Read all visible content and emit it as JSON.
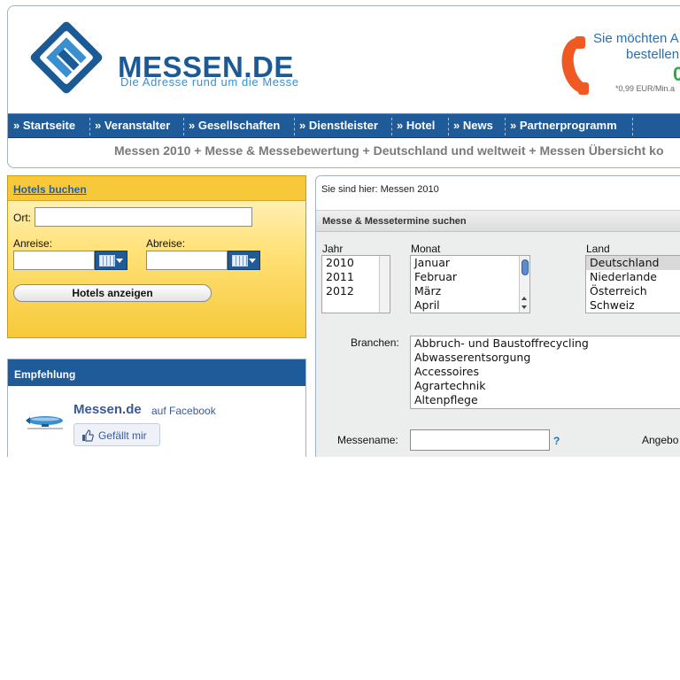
{
  "header": {
    "logo_text": "MESSEN.DE",
    "logo_sub": "Die Adresse rund um die Messe",
    "phone_line1": "Sie möchten A",
    "phone_line2": "bestellen",
    "phone_big": "0",
    "phone_price": "*0,99 EUR/Min.a",
    "tagline": "Messen 2010 + Messe & Messebewertung + Deutschland und weltweit + Messen Übersicht ko",
    "colors": {
      "brand": "#1c5a96",
      "nav": "#1f5a99",
      "accent": "#3a8fd0",
      "phone": "#f05a22"
    }
  },
  "nav": {
    "items": [
      {
        "label": "» Startseite"
      },
      {
        "label": "» Veranstalter"
      },
      {
        "label": "» Gesellschaften"
      },
      {
        "label": "» Dienstleister"
      },
      {
        "label": "» Hotel"
      },
      {
        "label": "» News"
      },
      {
        "label": "» Partnerprogramm"
      }
    ]
  },
  "hotel": {
    "title": "Hotels buchen",
    "ort_label": "Ort:",
    "anreise_label": "Anreise:",
    "abreise_label": "Abreise:",
    "ort_value": "",
    "anreise_value": "",
    "abreise_value": "",
    "button": "Hotels anzeigen",
    "icons": {
      "calendar": "calendar-icon",
      "dropdown": "chevron-down-icon"
    }
  },
  "empfehlung": {
    "title": "Empfehlung",
    "fb_name": "Messen.de",
    "fb_auf": "auf Facebook",
    "like": "Gefällt mir"
  },
  "search": {
    "breadcrumb": "Sie sind hier: Messen 2010",
    "title": "Messe & Messetermine suchen",
    "jahr_label": "Jahr",
    "monat_label": "Monat",
    "land_label": "Land",
    "branchen_label": "Branchen:",
    "messename_label": "Messename:",
    "messename_value": "",
    "angebot_label": "Angebo",
    "help": "?",
    "years": [
      "2010",
      "2011",
      "2012"
    ],
    "months": [
      "Januar",
      "Februar",
      "März",
      "April"
    ],
    "countries": [
      "Deutschland",
      "Niederlande",
      "Österreich",
      "Schweiz"
    ],
    "countries_selected": "Deutschland",
    "branchen": [
      "Abbruch- und Baustoffrecycling",
      "Abwasserentsorgung",
      "Accessoires",
      "Agrartechnik",
      "Altenpflege"
    ]
  }
}
